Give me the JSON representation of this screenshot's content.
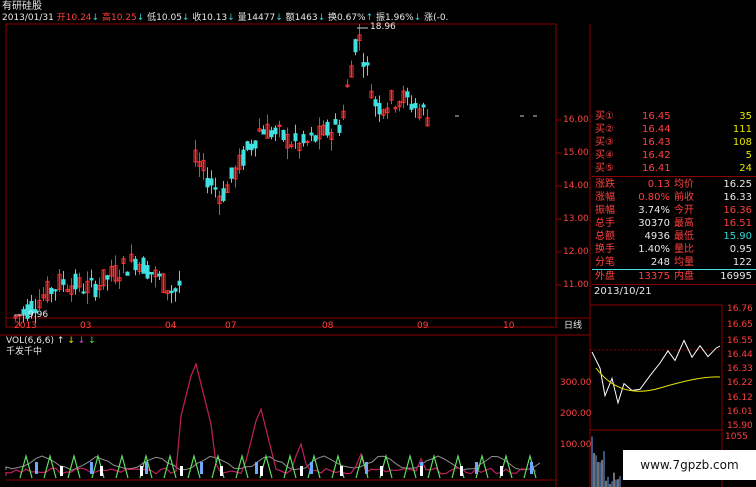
{
  "header": {
    "stock_name": "有研硅股",
    "date": "2013/01/31",
    "open_label": "开",
    "open": "10.24",
    "high_label": "高",
    "high": "10.25",
    "low_label": "低",
    "low": "10.05",
    "close_label": "收",
    "close": "10.13",
    "vol_label": "量",
    "vol": "14477",
    "amt_label": "额",
    "amt": "1463",
    "turn_label": "换",
    "turn": "0.67%",
    "amp_label": "振",
    "amp": "1.96%",
    "chg_label": "涨",
    "chg": "(-0."
  },
  "price_axis": [
    "16.00",
    "15.00",
    "14.00",
    "13.00",
    "12.00",
    "11.00"
  ],
  "high_mark": "18.96",
  "low_mark": "9.96",
  "date_axis": [
    "2013",
    "03",
    "04",
    "07",
    "08",
    "09",
    "10"
  ],
  "period_label": "日线",
  "vol_header": {
    "name": "VOL(6,6,6)",
    "arrows": [
      "↑",
      "↓",
      "↓",
      "↓"
    ]
  },
  "indicator_label": "千发千中",
  "vol_axis": [
    "300.00",
    "200.00",
    "100.00"
  ],
  "order_book": [
    {
      "label": "买①",
      "price": "16.45",
      "qty": "35"
    },
    {
      "label": "买②",
      "price": "16.44",
      "qty": "111"
    },
    {
      "label": "买③",
      "price": "16.43",
      "qty": "108"
    },
    {
      "label": "买④",
      "price": "16.42",
      "qty": "5"
    },
    {
      "label": "买⑤",
      "price": "16.41",
      "qty": "24"
    }
  ],
  "quote": [
    {
      "l1": "涨跌",
      "v1": "0.13",
      "l2": "均价",
      "v2": "16.25"
    },
    {
      "l1": "涨幅",
      "v1": "0.80%",
      "l2": "前收",
      "v2": "16.33"
    },
    {
      "l1": "振幅",
      "v1": "3.74%",
      "l2": "今开",
      "v2": "16.36"
    },
    {
      "l1": "总手",
      "v1": "30370",
      "l2": "最高",
      "v2": "16.51"
    },
    {
      "l1": "总额",
      "v1": "4936",
      "l2": "最低",
      "v2": "15.90"
    },
    {
      "l1": "换手",
      "v1": "1.40%",
      "l2": "量比",
      "v2": "0.95"
    },
    {
      "l1": "分笔",
      "v1": "248",
      "l2": "均量",
      "v2": "122"
    },
    {
      "l1": "外盘",
      "v1": "13375",
      "l2": "内盘",
      "v2": "16995"
    }
  ],
  "intraday": {
    "date": "2013/10/21",
    "axis": [
      "16.76",
      "16.65",
      "16.55",
      "16.44",
      "16.33",
      "16.22",
      "16.12",
      "16.01",
      "15.90"
    ],
    "vol_max": "1055"
  },
  "watermark": "www.7gpzb.com",
  "colors": {
    "up": "#ff3030",
    "down": "#40e0e0",
    "bg": "#000000",
    "grid": "#8b0000"
  }
}
